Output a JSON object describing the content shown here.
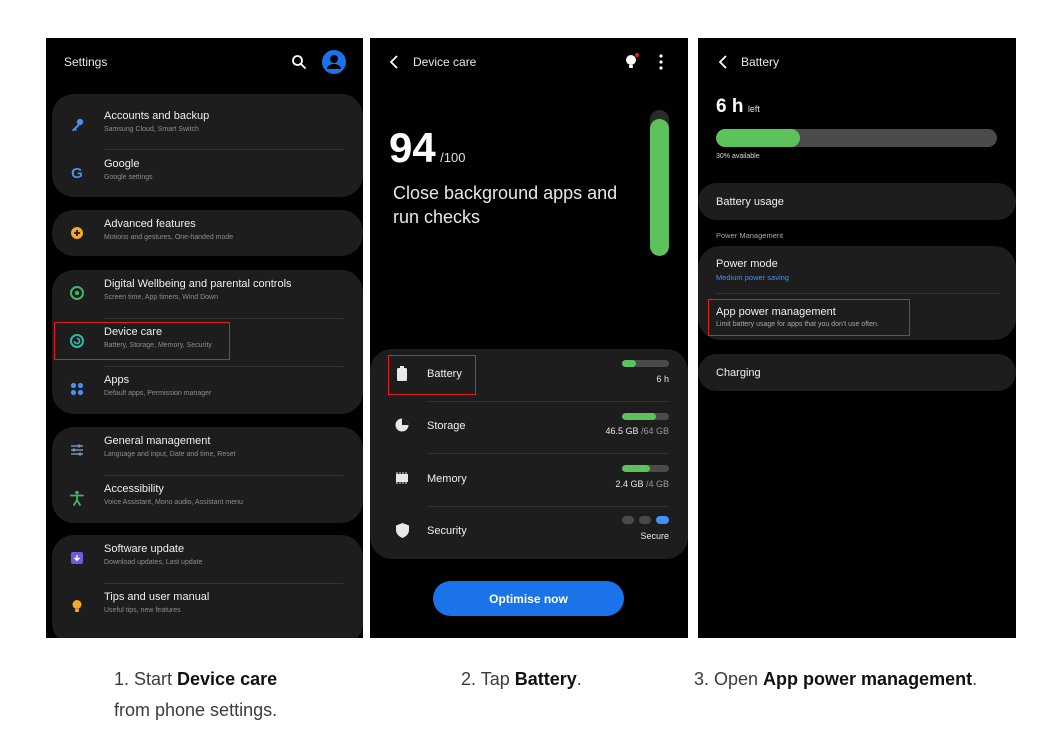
{
  "settings": {
    "title": "Settings",
    "groups": [
      [
        {
          "title": "Accounts and backup",
          "sub": "Samsung Cloud, Smart Switch",
          "icon": "key-icon"
        },
        {
          "title": "Google",
          "sub": "Google settings",
          "icon": "google-icon"
        }
      ],
      [
        {
          "title": "Advanced features",
          "sub": "Motions and gestures, One-handed mode",
          "icon": "gear-plus-icon"
        }
      ],
      [
        {
          "title": "Digital Wellbeing and parental controls",
          "sub": "Screen time, App timers, Wind Down",
          "icon": "wellbeing-icon"
        },
        {
          "title": "Device care",
          "sub": "Battery, Storage, Memory, Security",
          "icon": "device-care-icon"
        },
        {
          "title": "Apps",
          "sub": "Default apps, Permission manager",
          "icon": "apps-grid-icon"
        }
      ],
      [
        {
          "title": "General management",
          "sub": "Language and input, Date and time, Reset",
          "icon": "sliders-icon"
        },
        {
          "title": "Accessibility",
          "sub": "Voice Assistant, Mono audio, Assistant menu",
          "icon": "accessibility-icon"
        }
      ],
      [
        {
          "title": "Software update",
          "sub": "Download updates, Last update",
          "icon": "software-update-icon"
        },
        {
          "title": "Tips and user manual",
          "sub": "Useful tips, new features",
          "icon": "lightbulb-icon"
        }
      ]
    ]
  },
  "device_care": {
    "title": "Device care",
    "score": "94",
    "score_max": "/100",
    "score_fraction": 0.94,
    "message_line1": "Close background apps and",
    "message_line2": "run checks",
    "items": [
      {
        "label": "Battery",
        "value": "6 h",
        "value_muted": "",
        "fill": 0.3
      },
      {
        "label": "Storage",
        "value": "46.5 GB",
        "value_muted": " /64 GB",
        "fill": 0.73
      },
      {
        "label": "Memory",
        "value": "2.4 GB",
        "value_muted": " /4 GB",
        "fill": 0.6
      },
      {
        "label": "Security",
        "value": "Secure",
        "value_muted": "",
        "fill": 1
      }
    ],
    "button": "Optimise now"
  },
  "battery": {
    "title": "Battery",
    "hours": "6 h",
    "hours_suffix": "left",
    "available": "30% available",
    "available_fraction": 0.3,
    "battery_usage": "Battery usage",
    "section": "Power Management",
    "power_mode": "Power mode",
    "power_mode_sub": "Medium power saving",
    "app_power": "App power management",
    "app_power_sub": "Limit battery usage for apps that you don't use often.",
    "charging": "Charging"
  },
  "captions": {
    "step1_pre": "1. Start ",
    "step1_bold": "Device care",
    "step1_post": "from phone settings.",
    "step2_pre": "2. Tap ",
    "step2_bold": "Battery",
    "step2_post": ".",
    "step3_pre": "3. Open ",
    "step3_bold": "App power management",
    "step3_post": "."
  },
  "colors": {
    "accent_blue": "#1a73e8",
    "battery_green": "#5cc35c",
    "highlight_red": "#e02020",
    "link_blue": "#3e91ff"
  }
}
